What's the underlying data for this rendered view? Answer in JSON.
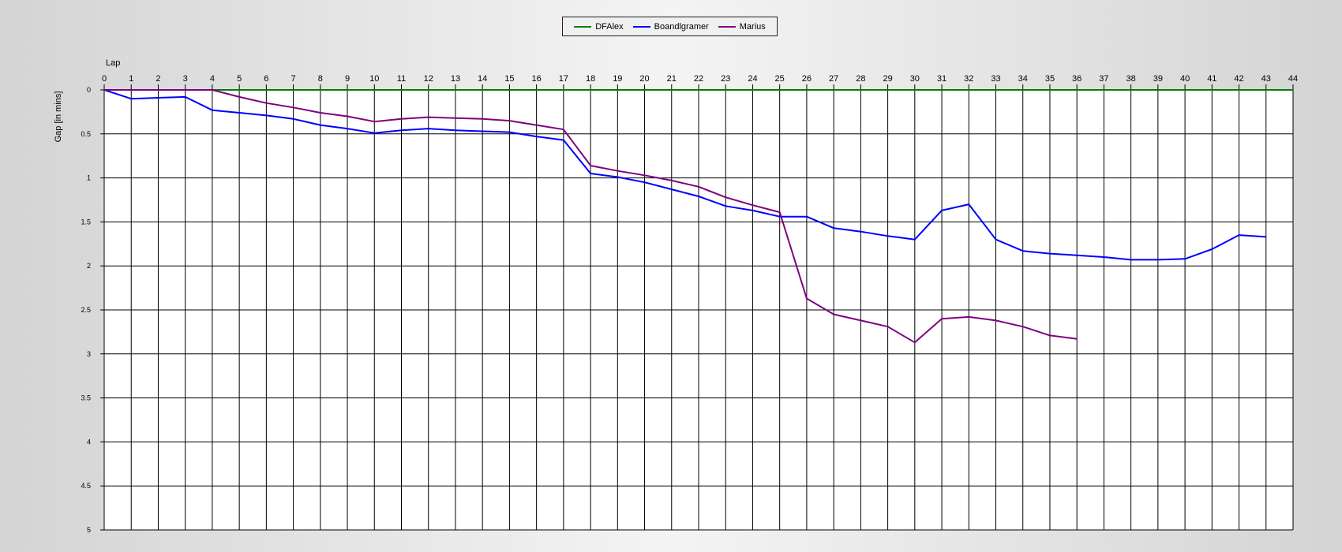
{
  "chart_data": {
    "type": "line",
    "xlabel": "Lap",
    "ylabel": "Gap [in mins]",
    "xlim": [
      0,
      44
    ],
    "ylim": [
      0,
      5
    ],
    "y_inverted": true,
    "grid": true,
    "legend_position": "top-center",
    "x_ticks": [
      0,
      1,
      2,
      3,
      4,
      5,
      6,
      7,
      8,
      9,
      10,
      11,
      12,
      13,
      14,
      15,
      16,
      17,
      18,
      19,
      20,
      21,
      22,
      23,
      24,
      25,
      26,
      27,
      28,
      29,
      30,
      31,
      32,
      33,
      34,
      35,
      36,
      37,
      38,
      39,
      40,
      41,
      42,
      43,
      44
    ],
    "y_ticks": [
      "0",
      "0.5",
      "1",
      "1.5",
      "2",
      "2.5",
      "3",
      "3.5",
      "4",
      "4.5",
      "5"
    ],
    "series": [
      {
        "name": "DFAlex",
        "color": "#008000",
        "x": [
          0,
          1,
          2,
          3,
          4,
          5,
          6,
          7,
          8,
          9,
          10,
          11,
          12,
          13,
          14,
          15,
          16,
          17,
          18,
          19,
          20,
          21,
          22,
          23,
          24,
          25,
          26,
          27,
          28,
          29,
          30,
          31,
          32,
          33,
          34,
          35,
          36,
          37,
          38,
          39,
          40,
          41,
          42,
          43,
          44
        ],
        "values": [
          0,
          0,
          0,
          0,
          0,
          0,
          0,
          0,
          0,
          0,
          0,
          0,
          0,
          0,
          0,
          0,
          0,
          0,
          0,
          0,
          0,
          0,
          0,
          0,
          0,
          0,
          0,
          0,
          0,
          0,
          0,
          0,
          0,
          0,
          0,
          0,
          0,
          0,
          0,
          0,
          0,
          0,
          0,
          0,
          0
        ]
      },
      {
        "name": "Boandlgramer",
        "color": "#0000ff",
        "x": [
          0,
          1,
          2,
          3,
          4,
          5,
          6,
          7,
          8,
          9,
          10,
          11,
          12,
          13,
          14,
          15,
          16,
          17,
          18,
          19,
          20,
          21,
          22,
          23,
          24,
          25,
          26,
          27,
          28,
          29,
          30,
          31,
          32,
          33,
          34,
          35,
          36,
          37,
          38,
          39,
          40,
          41,
          42,
          43
        ],
        "values": [
          0,
          0.1,
          0.09,
          0.08,
          0.23,
          0.26,
          0.29,
          0.33,
          0.4,
          0.44,
          0.49,
          0.46,
          0.44,
          0.46,
          0.47,
          0.48,
          0.53,
          0.57,
          0.95,
          0.99,
          1.05,
          1.13,
          1.21,
          1.32,
          1.37,
          1.44,
          1.44,
          1.57,
          1.61,
          1.66,
          1.7,
          1.37,
          1.3,
          1.7,
          1.83,
          1.86,
          1.88,
          1.9,
          1.93,
          1.93,
          1.92,
          1.81,
          1.65,
          1.67
        ]
      },
      {
        "name": "Marius",
        "color": "#800080",
        "x": [
          0,
          1,
          2,
          3,
          4,
          5,
          6,
          7,
          8,
          9,
          10,
          11,
          12,
          13,
          14,
          15,
          16,
          17,
          18,
          19,
          20,
          21,
          22,
          23,
          24,
          25,
          26,
          27,
          28,
          29,
          30,
          31,
          32,
          33,
          34,
          35,
          36
        ],
        "values": [
          0,
          0,
          0,
          0,
          0,
          0.08,
          0.15,
          0.2,
          0.26,
          0.3,
          0.36,
          0.33,
          0.31,
          0.32,
          0.33,
          0.35,
          0.4,
          0.45,
          0.86,
          0.92,
          0.97,
          1.03,
          1.1,
          1.22,
          1.31,
          1.39,
          2.37,
          2.55,
          2.62,
          2.69,
          2.87,
          2.6,
          2.58,
          2.62,
          2.69,
          2.79,
          2.83
        ]
      }
    ]
  }
}
